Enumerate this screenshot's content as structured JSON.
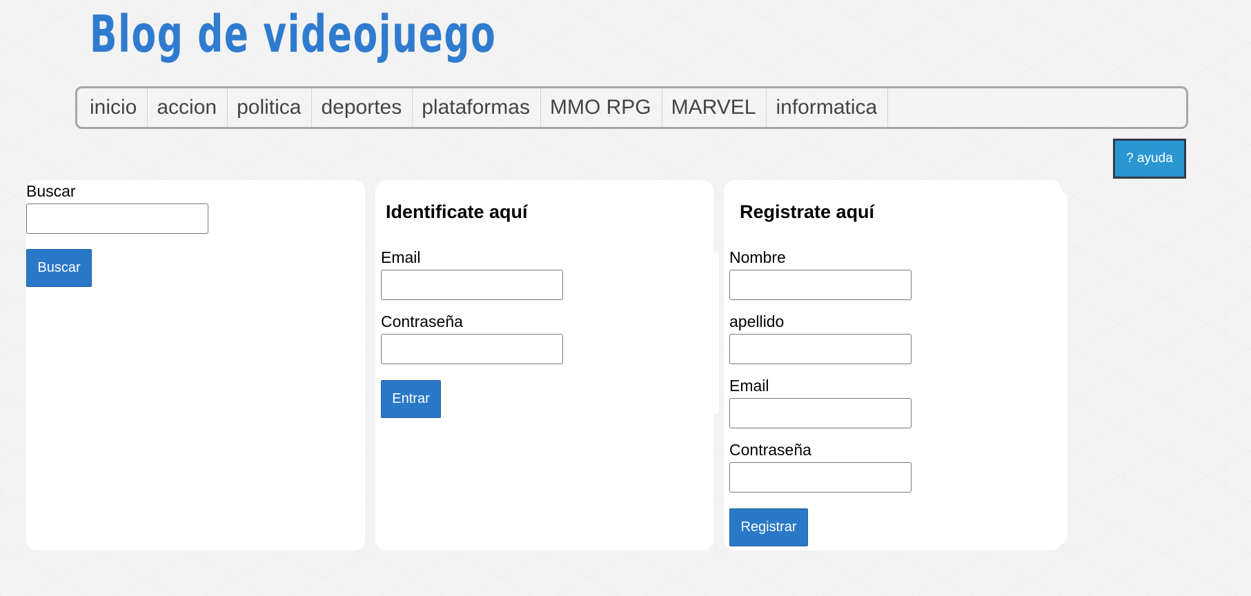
{
  "header": {
    "title": "Blog de videojuego"
  },
  "nav": {
    "items": [
      {
        "label": "inicio"
      },
      {
        "label": "accion"
      },
      {
        "label": "politica"
      },
      {
        "label": "deportes"
      },
      {
        "label": "plataformas"
      },
      {
        "label": "MMO RPG"
      },
      {
        "label": "MARVEL"
      },
      {
        "label": "informatica"
      }
    ]
  },
  "help": {
    "label": "? ayuda"
  },
  "search": {
    "label": "Buscar",
    "value": "",
    "button_label": "Buscar"
  },
  "login": {
    "heading": "Identificate aquí",
    "email_label": "Email",
    "email_value": "",
    "password_label": "Contraseña",
    "password_value": "",
    "button_label": "Entrar"
  },
  "register": {
    "heading": "Registrate aquí",
    "name_label": "Nombre",
    "name_value": "",
    "surname_label": "apellido",
    "surname_value": "",
    "email_label": "Email",
    "email_value": "",
    "password_label": "Contraseña",
    "password_value": "",
    "button_label": "Registrar"
  },
  "colors": {
    "title_blue": "#2f7bcf",
    "button_blue": "#2a78c8",
    "help_blue": "#2a97d3",
    "background": "#f3f3f3"
  }
}
